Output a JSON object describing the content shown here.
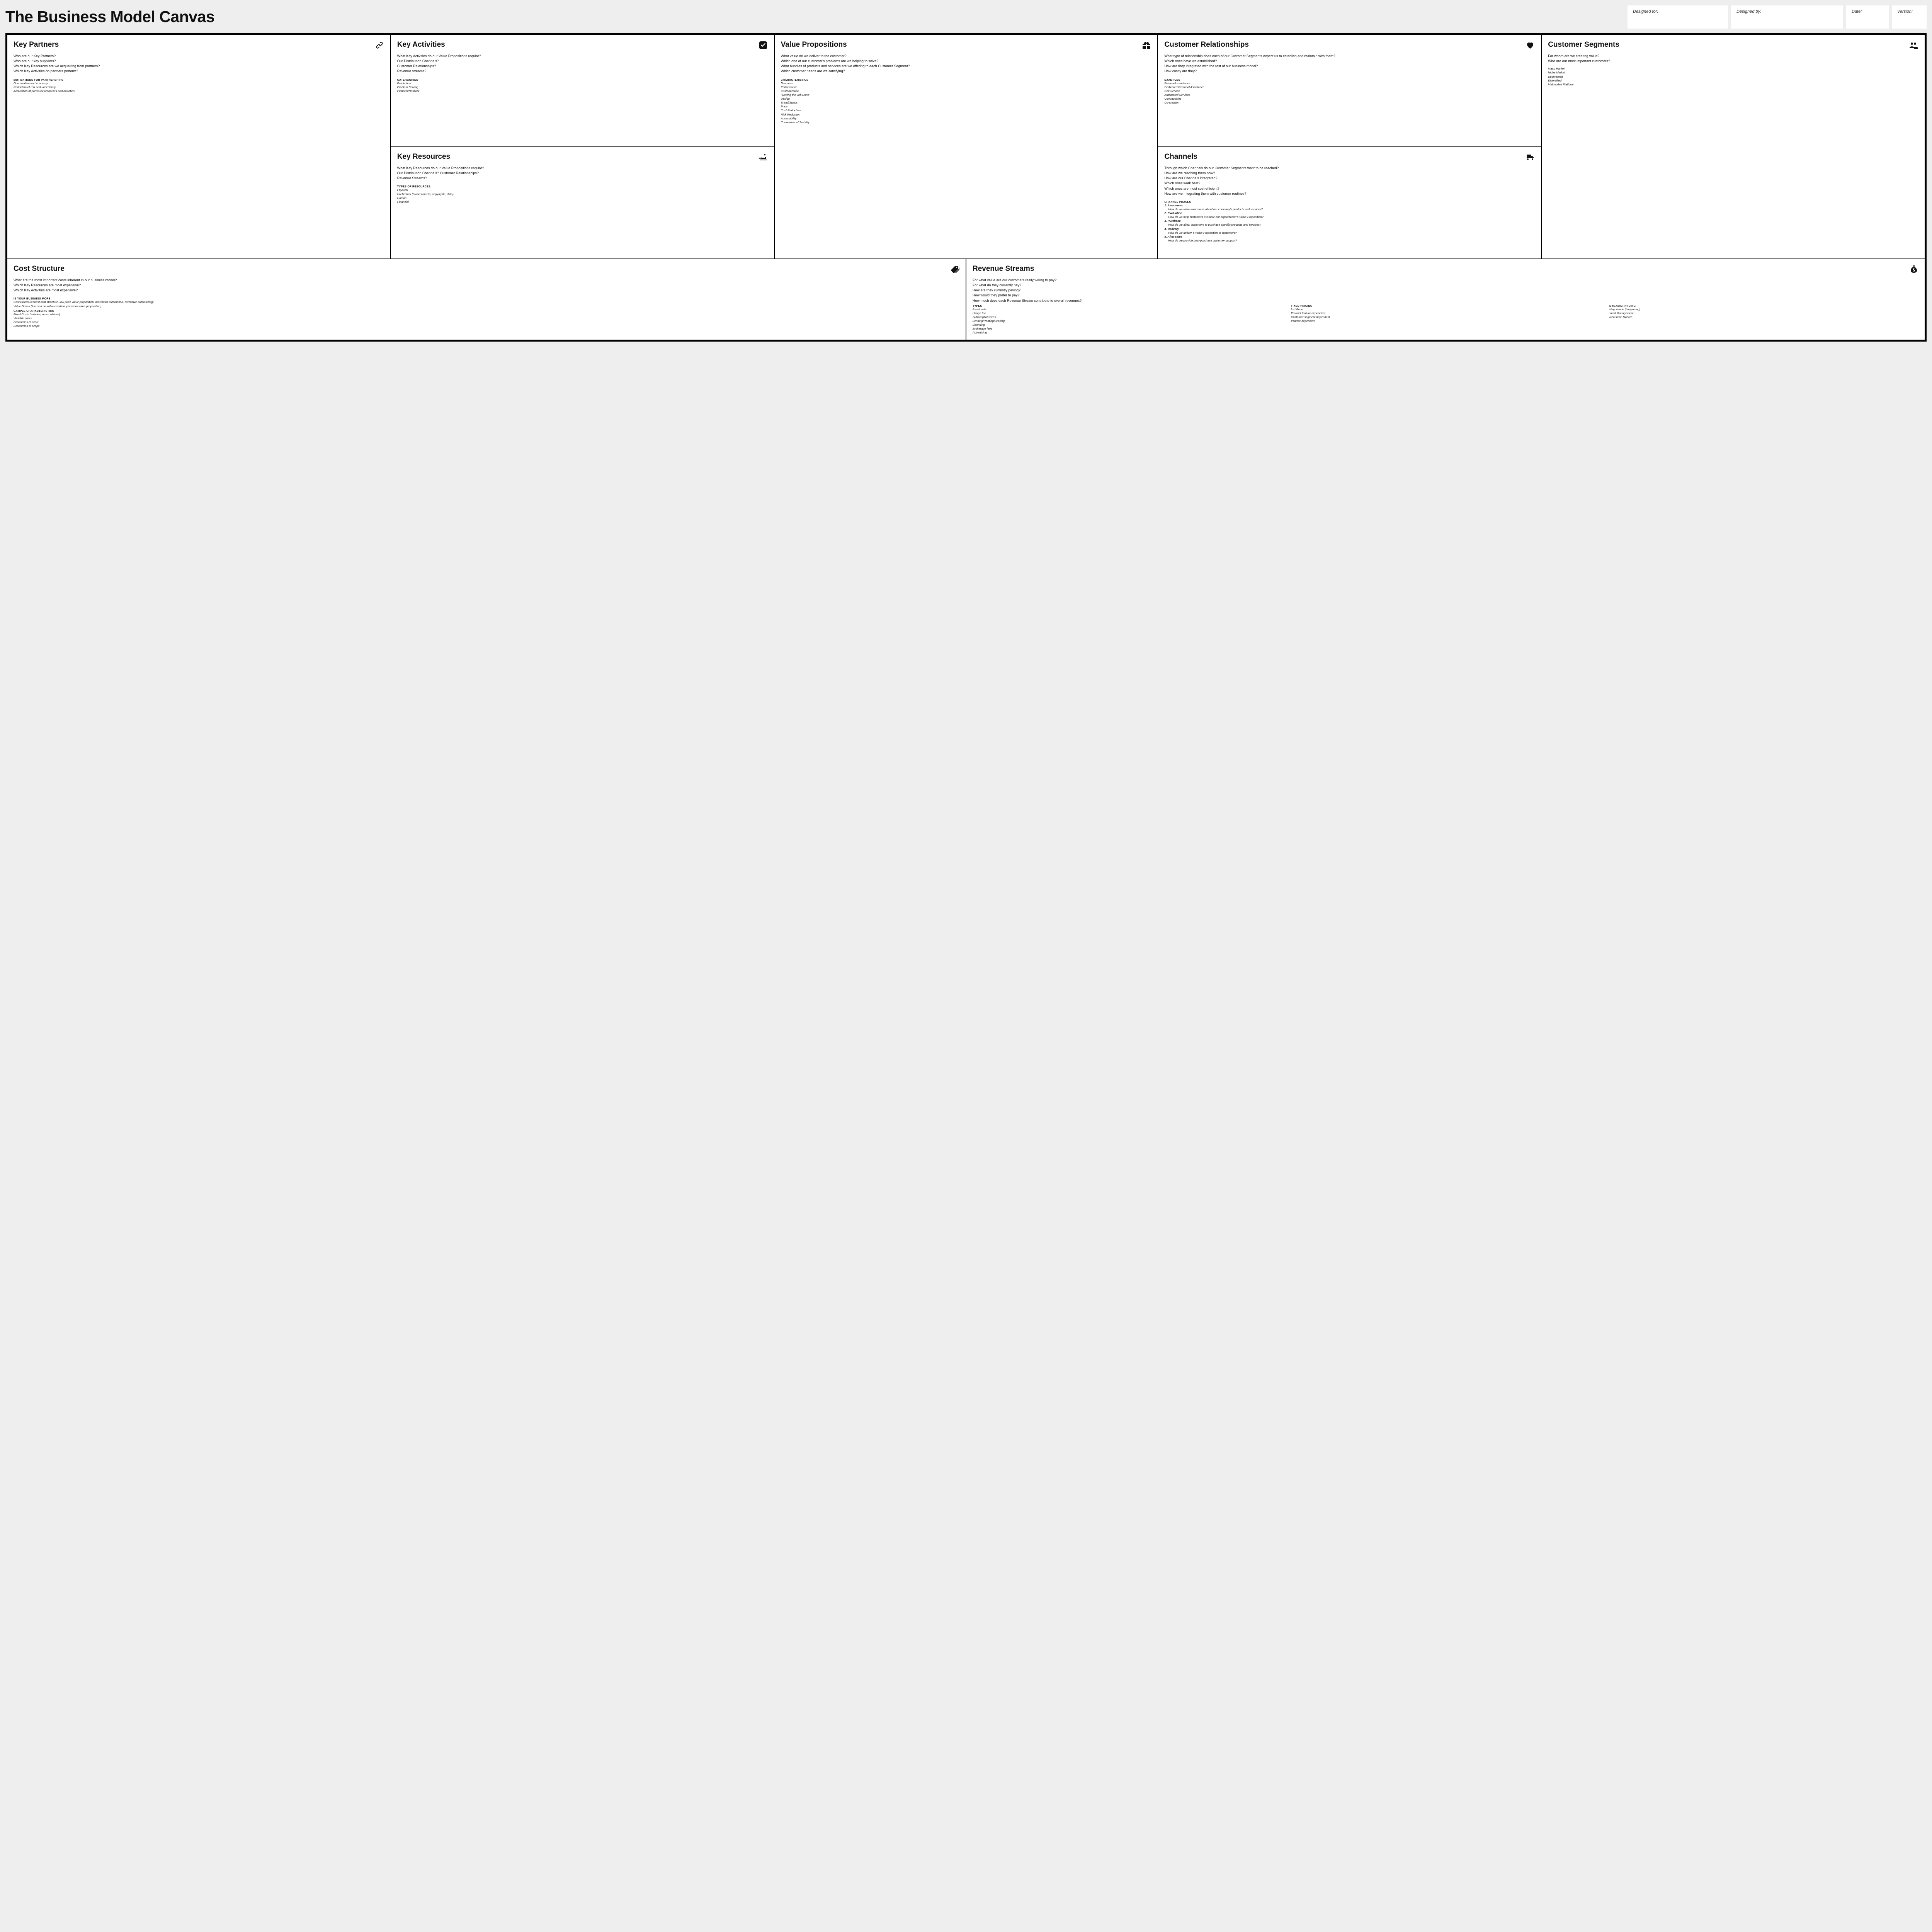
{
  "title": "The Business Model Canvas",
  "meta": {
    "designed_for": "Designed for:",
    "designed_by": "Designed by:",
    "date": "Date:",
    "version": "Version:"
  },
  "kp": {
    "title": "Key Partners",
    "q": [
      "Who are our Key Partners?",
      "Who are our key suppliers?",
      "Which Key Resources are we acquairing from partners?",
      "Which Key Activities do partners perform?"
    ],
    "sub": "motivations for partnerships",
    "items": [
      "Optimization and economy",
      "Reduction of risk and uncertainty",
      "Acquisition of particular resources and activities"
    ]
  },
  "ka": {
    "title": "Key Activities",
    "q": [
      "What Key Activities do our Value Propositions require?",
      "Our Distribution Channels?",
      "Customer Relationships?",
      "Revenue streams?"
    ],
    "sub": "catergories",
    "items": [
      "Production",
      "Problem Solving",
      "Platform/Network"
    ]
  },
  "kr": {
    "title": "Key Resources",
    "q": [
      "What Key Resources do our Value Propositions require?",
      "Our Distribution Channels? Customer Relationships?",
      "Revenue Streams?"
    ],
    "sub": "types of resources",
    "items": [
      "Physical",
      "Intellectual (brand patents, copyrights, data)",
      "Human",
      "Financial"
    ]
  },
  "vp": {
    "title": "Value Propositions",
    "q": [
      "What value do we deliver to the customer?",
      "Which one of our customer's problems are we helping to solve?",
      "What bundles of products and services are we offering to each Customer Segment?",
      "Which customer needs are we satisfying?"
    ],
    "sub": "characteristics",
    "items": [
      "Newness",
      "Performance",
      "Customization",
      "\"Getting the Job Done\"",
      "Design",
      "Brand/Status",
      "Price",
      "Cost Reduction",
      "Risk Reduction",
      "Accessibility",
      "Convenience/Usability"
    ]
  },
  "cr": {
    "title": "Customer Relationships",
    "q": [
      "What type of relationship does each of our Customer Segments expect us to establish and maintain with them?",
      "Which ones have we established?",
      "How are they integrated with the rest of our business model?",
      "How costly are they?"
    ],
    "sub": "examples",
    "items": [
      "Personal assistance",
      "Dedicated Personal Assistance",
      "Self-Service",
      "Automated Services",
      "Communities",
      "Co-creation"
    ]
  },
  "ch": {
    "title": "Channels",
    "q": [
      "Through which Channels do our Customer Segments want to be reached?",
      "How are we reaching them now?",
      "How are our Channels integrated?",
      "Which ones work best?",
      "Which ones are most cost-efficient?",
      "How are we integrating them with customer routines?"
    ],
    "sub": "channel phases",
    "phases": [
      {
        "t": "1. Awareness",
        "d": "How do we raise awareness about our company's products and services?"
      },
      {
        "t": "2. Evaluation",
        "d": "How do we help customers evaluate our organization's Value Proposition?"
      },
      {
        "t": "3. Purchase",
        "d": "How do we allow customers to purchase specific products and services?"
      },
      {
        "t": "4. Delivery",
        "d": "How do we deliver a Value Proposition to customers?"
      },
      {
        "t": "5. After sales",
        "d": "How do we provide post-purchase customer support?"
      }
    ]
  },
  "cs": {
    "title": "Customer Segments",
    "q": [
      "For whom are we creating value?",
      "Who are our most important customers?"
    ],
    "items": [
      "Mass Market",
      "Niche Market",
      "Segmented",
      "Diversified",
      "Multi-sided Platform"
    ]
  },
  "co": {
    "title": "Cost Structure",
    "q": [
      "What are the most important costs inherent in our business model?",
      "Which Key Resources are most expensive?",
      "Which Key Activities are most expensive?"
    ],
    "sub1": "is your business more",
    "items1": [
      "Cost Driven (leanest cost structure, low price value proposition, maximum automation, extensive outsourcing)",
      "Value Driven (focused on value creation, premium value proposition)"
    ],
    "sub2": "sample characteristics",
    "items2": [
      "Fixed Costs (salaries, rents, utilities)",
      "Variable costs",
      "Economies of scale",
      "Economies of scope"
    ]
  },
  "rs": {
    "title": "Revenue Streams",
    "q": [
      "For what value are our customers really willing to pay?",
      "For what do they currently pay?",
      "How are they currently paying?",
      "How would they prefer to pay?",
      "How much does each Revenue Stream contribute to overall revenues?"
    ],
    "col1_sub": "types",
    "col1": [
      "Asset sale",
      "Usage fee",
      "Subscription Fees",
      "Lending/Renting/Leasing",
      "Licensing",
      "Brokerage fees",
      "Advertising"
    ],
    "col2_sub": "fixed pricing",
    "col2": [
      "List Price",
      "Product feature dependent",
      "Customer segment dependent",
      "Volume dependent"
    ],
    "col3_sub": "dynamic pricing",
    "col3": [
      "Negotiation (bargaining)",
      "Yield Management",
      "Real-time-Market"
    ]
  }
}
